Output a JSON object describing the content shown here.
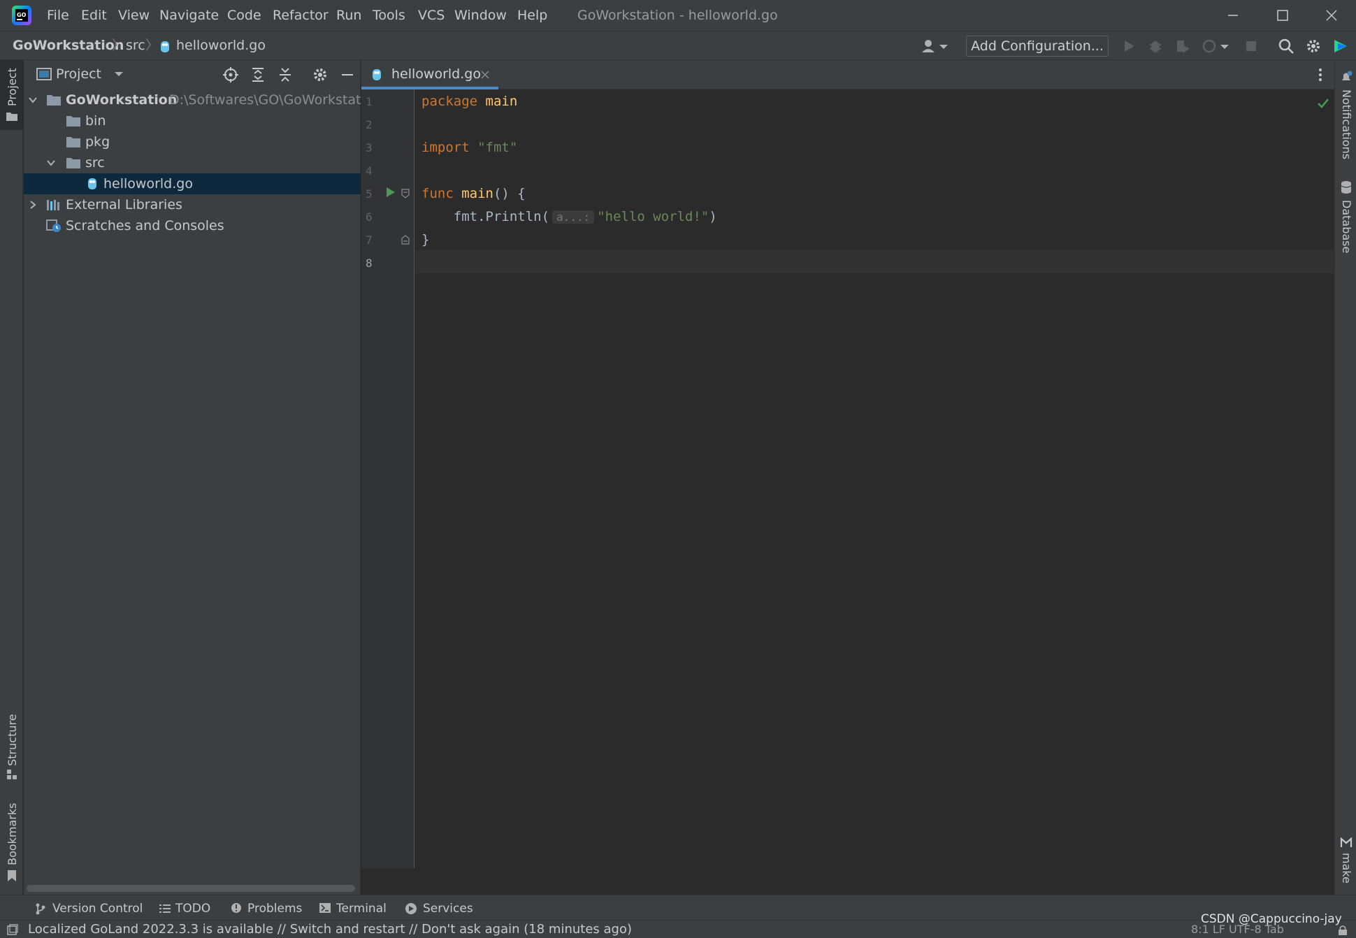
{
  "menu": [
    "File",
    "Edit",
    "View",
    "Navigate",
    "Code",
    "Refactor",
    "Run",
    "Tools",
    "VCS",
    "Window",
    "Help"
  ],
  "window_title": "GoWorkstation - helloworld.go",
  "breadcrumb": {
    "project": "GoWorkstation",
    "folder": "src",
    "file": "helloworld.go"
  },
  "toolbar": {
    "add_configuration": "Add Configuration..."
  },
  "left_stripe": {
    "project": "Project",
    "structure": "Structure",
    "bookmarks": "Bookmarks"
  },
  "right_stripe": {
    "notifications": "Notifications",
    "database": "Database",
    "make": "make"
  },
  "project_panel": {
    "title": "Project",
    "tree": {
      "root_name": "GoWorkstation",
      "root_path": "D:\\Softwares\\GO\\GoWorkstation",
      "bin": "bin",
      "pkg": "pkg",
      "src": "src",
      "file": "helloworld.go",
      "external_libraries": "External Libraries",
      "scratches": "Scratches and Consoles"
    }
  },
  "editor": {
    "tab_label": "helloworld.go",
    "line_numbers": [
      "1",
      "2",
      "3",
      "4",
      "5",
      "6",
      "7",
      "8"
    ],
    "code": {
      "kw_package": "package",
      "pkg_name": "main",
      "kw_import": "import",
      "import_path": "\"fmt\"",
      "kw_func": "func",
      "fn_name": "main",
      "fn_sig": "() {",
      "call": "fmt.Println(",
      "param_hint": "a...:",
      "arg": "\"hello world!\"",
      "call_close": ")",
      "close_brace": "}"
    }
  },
  "bottom_tools": [
    "Version Control",
    "TODO",
    "Problems",
    "Terminal",
    "Services"
  ],
  "status": {
    "message": "Localized GoLand 2022.3.3 is available // Switch and restart // Don't ask again (18 minutes ago)",
    "right": "8:1   LF   UTF-8   Tab"
  },
  "watermark": "CSDN @Cappuccino-jay",
  "colors": {
    "accent": "#4a88c7",
    "selection": "#0d293e",
    "keyword": "#cc7832",
    "string": "#6a8759",
    "function": "#ffc66d"
  }
}
